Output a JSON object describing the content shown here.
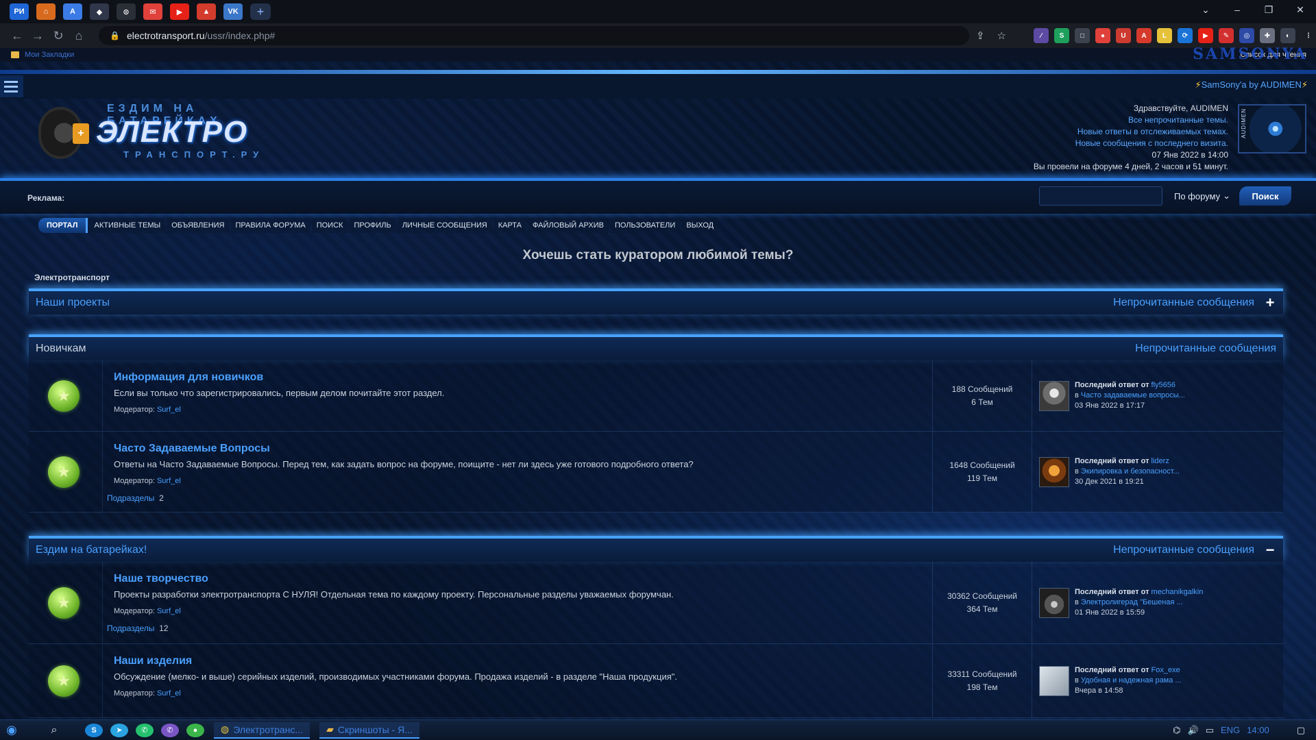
{
  "browser": {
    "url_host": "electrotransport.ru",
    "url_path": "/ussr/index.php#",
    "bookmarks_folder": "Мои Закладки",
    "reading_list": "Список для чтения",
    "theme_logo": "SAMSONYA",
    "tab_icons": [
      {
        "name": "ru-site-tab",
        "label": "РИ",
        "color": "#1f66d6"
      },
      {
        "name": "shield-tab",
        "label": "⌂",
        "color": "#d86a1e"
      },
      {
        "name": "docs-tab",
        "label": "A",
        "color": "#3b7be6"
      },
      {
        "name": "cube-tab",
        "label": "◆",
        "color": "#30374a"
      },
      {
        "name": "github-tab",
        "label": "⊙",
        "color": "#2a2e37"
      },
      {
        "name": "mail-tab",
        "label": "✉",
        "color": "#e0413a"
      },
      {
        "name": "youtube-tab",
        "label": "▶",
        "color": "#e62117"
      },
      {
        "name": "warning-tab",
        "label": "▲",
        "color": "#d33b2c"
      },
      {
        "name": "vk-tab",
        "label": "VK",
        "color": "#3b77c8"
      }
    ],
    "extensions": [
      {
        "label": "∕",
        "color": "#5c4aa3"
      },
      {
        "label": "S",
        "color": "#1ea05c"
      },
      {
        "label": "□",
        "color": "#3c434f"
      },
      {
        "label": "●",
        "color": "#e0413a"
      },
      {
        "label": "U",
        "color": "#cc3a30"
      },
      {
        "label": "A",
        "color": "#d53a2c"
      },
      {
        "label": "L",
        "color": "#e6c23a"
      },
      {
        "label": "⟳",
        "color": "#1a74d8"
      },
      {
        "label": "▶",
        "color": "#e62117"
      },
      {
        "label": "✎",
        "color": "#d32f2f"
      },
      {
        "label": "◎",
        "color": "#2d4aa6"
      },
      {
        "label": "✚",
        "color": "#6a7080"
      },
      {
        "label": "◐",
        "color": "#3b4250"
      }
    ]
  },
  "header": {
    "samsony_by": "SamSony'a by AUDIMEN",
    "logo": {
      "top": "ЕЗДИМ НА БАТАРЕЙКАХ",
      "main": "ЭЛЕКТРО",
      "bottom": "ТРАНСПОРТ.РУ"
    },
    "user": {
      "greeting": "Здравствуйте, AUDIMEN",
      "links": [
        "Все непрочитанные темы.",
        "Новые ответы в отслеживаемых темах.",
        "Новые сообщения с последнего визита."
      ],
      "date": "07 Янв 2022 в 14:00",
      "time_spent": "Вы провели на форуме 4 дней, 2 часов и 51 минут.",
      "avatar_tag": "AUDIMEN"
    }
  },
  "adbar": {
    "label": "Реклама:",
    "search_scope": "По форуму",
    "search_button": "Поиск"
  },
  "nav": [
    "ПОРТАЛ",
    "АКТИВНЫЕ ТЕМЫ",
    "ОБЪЯВЛЕНИЯ",
    "ПРАВИЛА ФОРУМА",
    "ПОИСК",
    "ПРОФИЛЬ",
    "ЛИЧНЫЕ СООБЩЕНИЯ",
    "КАРТА",
    "ФАЙЛОВЫЙ АРХИВ",
    "ПОЛЬЗОВАТЕЛИ",
    "ВЫХОД"
  ],
  "announce": "Хочешь стать куратором любимой темы?",
  "breadcrumb": "Электротранспорт",
  "categories": [
    {
      "title": "Наши проекты",
      "unread": "Непрочитанные сообщения",
      "toggle": "+"
    },
    {
      "title": "Новичкам",
      "unread": "Непрочитанные сообщения",
      "forums": [
        {
          "title": "Информация для новичков",
          "desc": "Если вы только что зарегистрировались, первым делом почитайте этот раздел.",
          "mod_label": "Модератор:",
          "mod": "Surf_el",
          "messages": "188 Сообщений",
          "topics": "6 Тем",
          "lp_label": "Последний ответ от",
          "lp_user": "fly5656",
          "lp_in": "в",
          "lp_topic": "Часто задаваемые вопросы...",
          "lp_date": "03 Янв 2022 в 17:17"
        },
        {
          "title": "Часто Задаваемые Вопросы",
          "desc": "Ответы на Часто Задаваемые Вопросы. Перед тем, как задать вопрос на форуме, поищите - нет ли здесь уже готового подробного ответа?",
          "mod_label": "Модератор:",
          "mod": "Surf_el",
          "subs_label": "Подразделы",
          "subs": "2",
          "messages": "1648 Сообщений",
          "topics": "119 Тем",
          "lp_label": "Последний ответ от",
          "lp_user": "liderz",
          "lp_in": "в",
          "lp_topic": "Экипировка и безопасност...",
          "lp_date": "30 Дек 2021 в 19:21"
        }
      ]
    },
    {
      "title": "Ездим на батарейках!",
      "unread": "Непрочитанные сообщения",
      "toggle": "−",
      "forums": [
        {
          "title": "Наше творчество",
          "desc": "Проекты разработки электротранспорта С НУЛЯ! Отдельная тема по каждому проекту. Персональные разделы уважаемых форумчан.",
          "mod_label": "Модератор:",
          "mod": "Surf_el",
          "subs_label": "Подразделы",
          "subs": "12",
          "messages": "30362 Сообщений",
          "topics": "364 Тем",
          "lp_label": "Последний ответ от",
          "lp_user": "mechanikgalkin",
          "lp_in": "в",
          "lp_topic": "Электролигерад \"Бешеная ...",
          "lp_date": "01 Янв 2022 в 15:59"
        },
        {
          "title": "Наши изделия",
          "desc": "Обсуждение (мелко- и выше) серийных изделий, производимых участниками форума. Продажа изделий - в разделе \"Наша продукция\".",
          "mod_label": "Модератор:",
          "mod": "Surf_el",
          "messages": "33311 Сообщений",
          "topics": "198 Тем",
          "lp_label": "Последний ответ от",
          "lp_user": "Fox_exe",
          "lp_in": "в",
          "lp_topic": "Удобная и надежная рама ...",
          "lp_date": "Вчера в 14:58"
        }
      ]
    }
  ],
  "taskbar": {
    "apps": [
      {
        "label": "Электротранс...",
        "icon": "chrome-icon"
      },
      {
        "label": "Скриншоты - Я...",
        "icon": "folder-icon"
      }
    ],
    "lang": "ENG",
    "time": "14:00"
  }
}
